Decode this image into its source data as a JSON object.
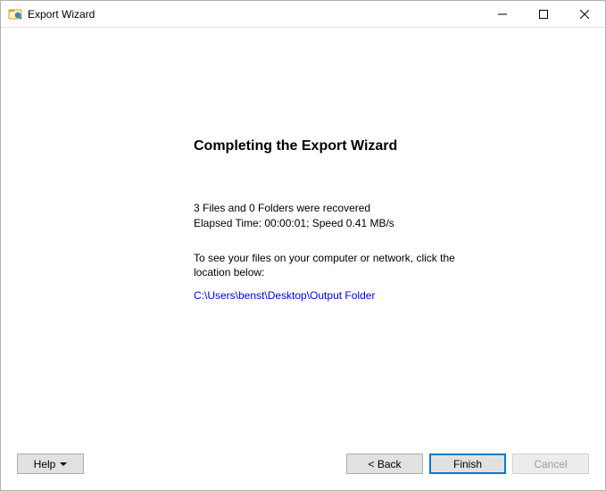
{
  "titlebar": {
    "title": "Export Wizard"
  },
  "content": {
    "heading": "Completing the Export Wizard",
    "summary_line1": "3 Files and 0 Folders were recovered",
    "summary_line2": "Elapsed Time: 00:00:01; Speed 0.41 MB/s",
    "instruction": "To see your files on your computer or network, click the location below:",
    "link": "C:\\Users\\benst\\Desktop\\Output Folder"
  },
  "footer": {
    "help_label": "Help",
    "back_label": "< Back",
    "finish_label": "Finish",
    "cancel_label": "Cancel"
  }
}
